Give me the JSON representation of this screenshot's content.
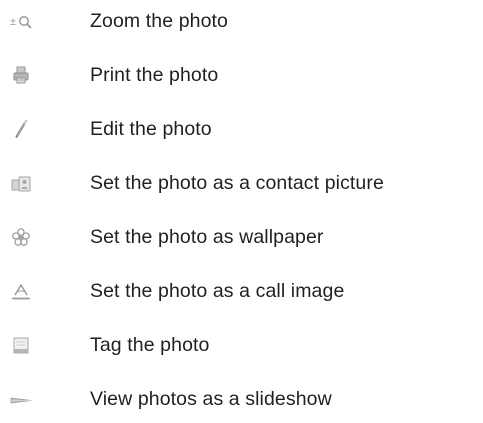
{
  "menu": {
    "items": [
      {
        "icon": "zoom-icon",
        "label": "Zoom the photo"
      },
      {
        "icon": "printer-icon",
        "label": "Print the photo"
      },
      {
        "icon": "pencil-icon",
        "label": "Edit the photo"
      },
      {
        "icon": "contact-picture-icon",
        "label": "Set the photo as a contact picture"
      },
      {
        "icon": "wallpaper-flower-icon",
        "label": "Set the photo as wallpaper"
      },
      {
        "icon": "call-image-icon",
        "label": "Set the photo as a call image"
      },
      {
        "icon": "tag-icon",
        "label": "Tag the photo"
      },
      {
        "icon": "slideshow-icon",
        "label": "View photos as a slideshow"
      }
    ]
  }
}
